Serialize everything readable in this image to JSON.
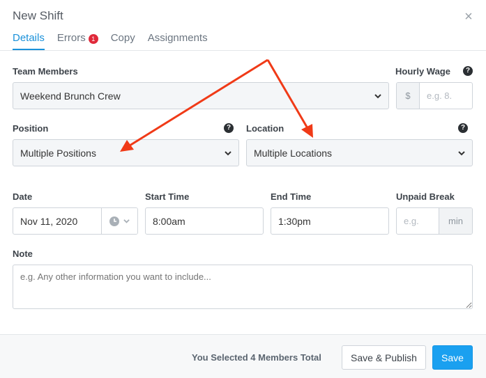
{
  "modal": {
    "title": "New Shift",
    "close_glyph": "×"
  },
  "tabs": [
    {
      "label": "Details",
      "active": true
    },
    {
      "label": "Errors",
      "badge": "1"
    },
    {
      "label": "Copy"
    },
    {
      "label": "Assignments"
    }
  ],
  "form": {
    "team_members": {
      "label": "Team Members",
      "value": "Weekend Brunch Crew"
    },
    "hourly_wage": {
      "label": "Hourly Wage",
      "prefix": "$",
      "placeholder": "e.g. 8."
    },
    "position": {
      "label": "Position",
      "value": "Multiple Positions"
    },
    "location": {
      "label": "Location",
      "value": "Multiple Locations"
    },
    "date": {
      "label": "Date",
      "value": "Nov 11, 2020"
    },
    "start_time": {
      "label": "Start Time",
      "value": "8:00am"
    },
    "end_time": {
      "label": "End Time",
      "value": "1:30pm"
    },
    "unpaid_break": {
      "label": "Unpaid Break",
      "placeholder": "e.g.",
      "suffix": "min"
    },
    "note": {
      "label": "Note",
      "placeholder": "e.g. Any other information you want to include..."
    },
    "help_glyph": "?"
  },
  "footer": {
    "selected_text": "You Selected 4 Members Total",
    "save_publish_label": "Save & Publish",
    "save_label": "Save"
  },
  "colors": {
    "accent": "#1a91da",
    "primary_button": "#1aa0f0",
    "error_badge": "#e0293a",
    "annotation_arrow": "#f03a17"
  },
  "icons": [
    "close-icon",
    "help-icon",
    "chevron-down-icon",
    "clock-icon",
    "annotation-arrow"
  ]
}
